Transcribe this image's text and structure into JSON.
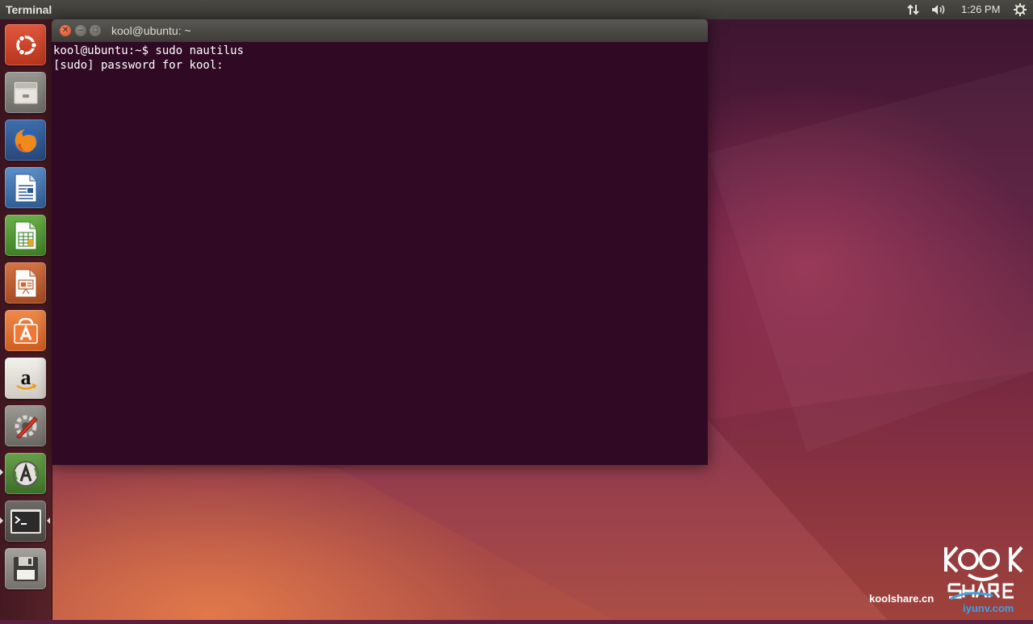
{
  "top_panel": {
    "app_title": "Terminal",
    "clock": "1:26 PM",
    "indicators": [
      "network-icon",
      "volume-icon",
      "settings-gear-icon"
    ]
  },
  "launcher": {
    "items": [
      {
        "icon": "ubuntu-dash-icon"
      },
      {
        "icon": "files-icon"
      },
      {
        "icon": "firefox-icon"
      },
      {
        "icon": "libreoffice-writer-icon"
      },
      {
        "icon": "libreoffice-calc-icon"
      },
      {
        "icon": "libreoffice-impress-icon"
      },
      {
        "icon": "software-center-icon"
      },
      {
        "icon": "amazon-icon"
      },
      {
        "icon": "system-settings-icon"
      },
      {
        "icon": "software-updater-icon"
      },
      {
        "icon": "terminal-icon"
      },
      {
        "icon": "floppy-save-icon"
      }
    ]
  },
  "terminal": {
    "title": "kool@ubuntu: ~",
    "lines": [
      "kool@ubuntu:~$ sudo nautilus",
      "[sudo] password for kool:"
    ]
  },
  "watermark": {
    "site": "koolshare.cn",
    "site2": "iyunv.com"
  },
  "colors": {
    "terminal_bg": "#300a24",
    "close_button": "#e05a2f",
    "panel_bg": "#3e3d39"
  }
}
